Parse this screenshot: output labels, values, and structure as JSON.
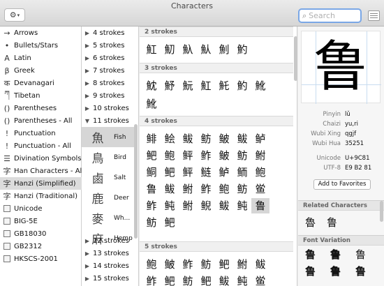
{
  "window": {
    "title": "Characters"
  },
  "toolbar": {
    "gear_icon": "gear-icon",
    "search_placeholder": "Search"
  },
  "categories": [
    {
      "icon": "→",
      "label": "Arrows"
    },
    {
      "icon": "•",
      "label": "Bullets/Stars"
    },
    {
      "icon": "A",
      "label": "Latin"
    },
    {
      "icon": "β",
      "label": "Greek"
    },
    {
      "icon": "क",
      "label": "Devanagari"
    },
    {
      "icon": "ཀ",
      "label": "Tibetan"
    },
    {
      "icon": "()",
      "label": "Parentheses"
    },
    {
      "icon": "()",
      "label": "Parentheses - All"
    },
    {
      "icon": "!",
      "label": "Punctuation"
    },
    {
      "icon": "!",
      "label": "Punctuation - All"
    },
    {
      "icon": "☰",
      "label": "Divination Symbols"
    },
    {
      "icon": "字",
      "label": "Han Characters - All"
    },
    {
      "icon": "字",
      "label": "Hanzi (Simplified)"
    },
    {
      "icon": "字",
      "label": "Hanzi (Traditional)"
    },
    {
      "icon": "",
      "label": "Unicode"
    },
    {
      "icon": "",
      "label": "BIG-5E"
    },
    {
      "icon": "",
      "label": "GB18030"
    },
    {
      "icon": "",
      "label": "GB2312"
    },
    {
      "icon": "",
      "label": "HKSCS-2001"
    }
  ],
  "strokes_top": [
    "4 strokes",
    "5 strokes",
    "6 strokes",
    "7 strokes",
    "8 strokes",
    "9 strokes",
    "10 strokes",
    "11 strokes"
  ],
  "radicals": [
    {
      "glyph": "魚",
      "name": "Fish"
    },
    {
      "glyph": "鳥",
      "name": "Bird"
    },
    {
      "glyph": "鹵",
      "name": "Salt"
    },
    {
      "glyph": "鹿",
      "name": "Deer"
    },
    {
      "glyph": "麥",
      "name": "Wh..."
    },
    {
      "glyph": "麻",
      "name": "Hemp"
    }
  ],
  "strokes_bottom": [
    "12 strokes",
    "13 strokes",
    "14 strokes",
    "15 strokes"
  ],
  "sections": [
    {
      "label": "2 strokes",
      "rows": [
        [
          "魟",
          "魛",
          "魞",
          "魜",
          "魝",
          "魡"
        ]
      ]
    },
    {
      "label": "3 strokes",
      "rows": [
        [
          "魫",
          "魣",
          "魭",
          "魟",
          "魠",
          "魡",
          "魤"
        ],
        [
          "魤"
        ]
      ]
    },
    {
      "label": "4 strokes",
      "rows": [
        [
          "鲱",
          "鲙",
          "鲅",
          "鲂",
          "鲏",
          "鲅",
          "鲈"
        ],
        [
          "鲃",
          "鲍",
          "鲆",
          "鲊",
          "鲏",
          "鲂",
          "鲋"
        ],
        [
          "鲖",
          "鲃",
          "鲆",
          "鲢",
          "鲈",
          "鲕",
          "鲍"
        ],
        [
          "鲁",
          "鲅",
          "鲋",
          "鲊",
          "鲍",
          "鲂",
          "鲎"
        ],
        [
          "鲊",
          "鲀",
          "鲋",
          "鲵",
          "鲅",
          "鲀",
          "鲁"
        ],
        [
          "鲂",
          "鲃"
        ]
      ]
    },
    {
      "label": "5 strokes",
      "rows": [
        [
          "鲍",
          "鲏",
          "鲊",
          "鲂",
          "鲃",
          "鲋",
          "鲅"
        ],
        [
          "鲊",
          "鲃",
          "鲂",
          "鲃",
          "鲅",
          "鲀",
          "鲎"
        ]
      ]
    }
  ],
  "selected_char": {
    "glyph": "鲁",
    "fields": [
      {
        "key": "Pinyin",
        "value": "lǔ"
      },
      {
        "key": "Chaizi",
        "value": "yu,ri"
      },
      {
        "key": "Wubi Xing",
        "value": "qgjf"
      },
      {
        "key": "Wubi Hua",
        "value": "35251"
      },
      {
        "key": "Unicode",
        "value": "U+9C81"
      },
      {
        "key": "UTF-8",
        "value": "E9 B2 81"
      }
    ],
    "favorites_label": "Add to Favorites"
  },
  "related": {
    "label": "Related Characters",
    "chars": [
      "魯",
      "鲁"
    ]
  },
  "variation": {
    "label": "Font Variation",
    "chars": [
      "鲁",
      "鲁",
      "鲁",
      "鲁",
      "鲁",
      "鲁"
    ]
  }
}
